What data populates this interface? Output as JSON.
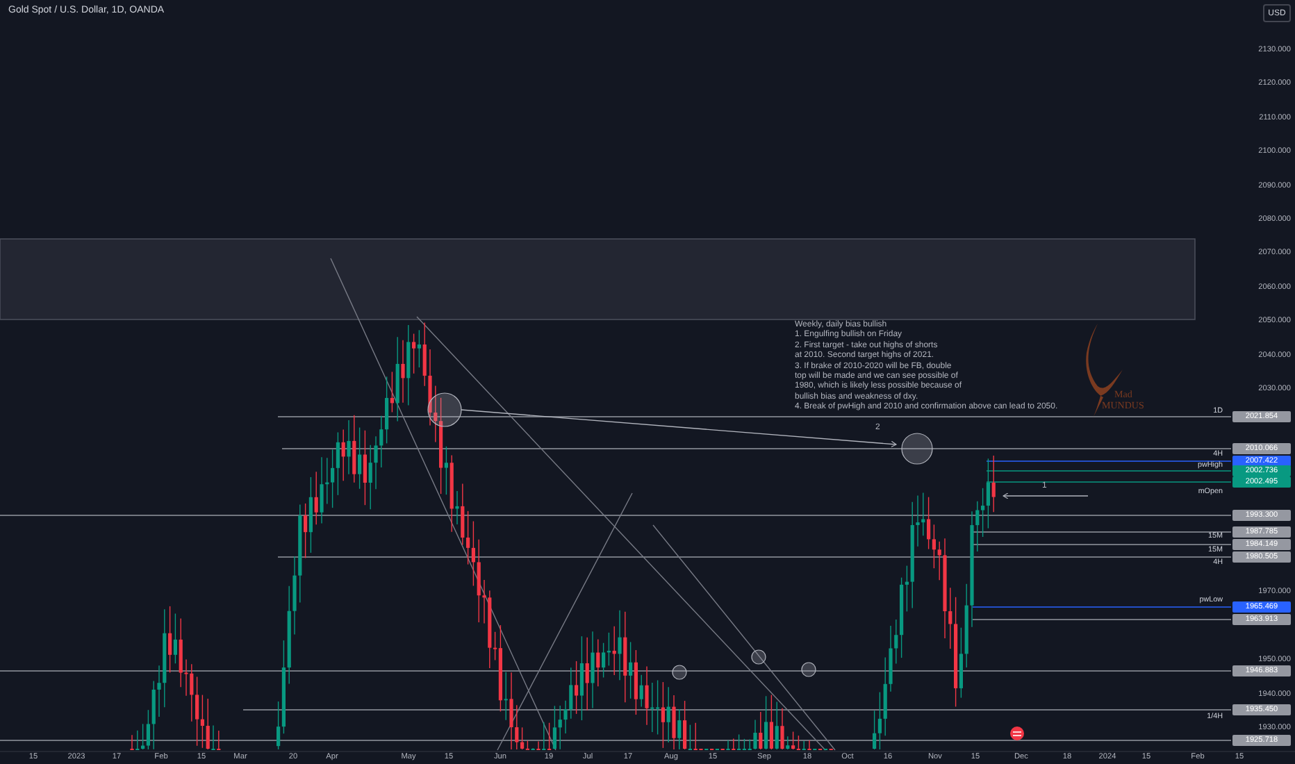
{
  "header": {
    "title": "Gold Spot / U.S. Dollar, 1D, OANDA",
    "currency": "USD"
  },
  "price_ticks": [
    "2130.000",
    "2120.000",
    "2110.000",
    "2100.000",
    "2090.000",
    "2080.000",
    "2070.000",
    "2060.000",
    "2050.000",
    "2040.000",
    "2030.000",
    "1970.000",
    "1950.000",
    "1940.000",
    "1930.000"
  ],
  "price_labels": [
    {
      "text": "2021.854",
      "color": "#9598a1"
    },
    {
      "text": "2010.066",
      "color": "#9598a1"
    },
    {
      "text": "2007.422",
      "color": "#2962ff"
    },
    {
      "text": "2002.736",
      "color": "#089981"
    },
    {
      "text": "2002.495",
      "color": "#089981"
    },
    {
      "text": "1993.300",
      "color": "#9598a1"
    },
    {
      "text": "1987.785",
      "color": "#9598a1"
    },
    {
      "text": "1984.149",
      "color": "#9598a1"
    },
    {
      "text": "1980.505",
      "color": "#9598a1"
    },
    {
      "text": "1965.469",
      "color": "#2962ff"
    },
    {
      "text": "1963.913",
      "color": "#9598a1"
    },
    {
      "text": "1946.883",
      "color": "#9598a1"
    },
    {
      "text": "1935.450",
      "color": "#9598a1"
    },
    {
      "text": "1925.718",
      "color": "#9598a1"
    }
  ],
  "line_tags": [
    "1D",
    "4H",
    "pwHigh",
    "mOpen",
    "15M",
    "15M",
    "4H",
    "pwLow",
    "1/4H"
  ],
  "time_axis": [
    "15",
    "2023",
    "17",
    "Feb",
    "15",
    "Mar",
    "20",
    "Apr",
    "May",
    "15",
    "Jun",
    "19",
    "Jul",
    "17",
    "Aug",
    "15",
    "Sep",
    "18",
    "Oct",
    "16",
    "Nov",
    "15",
    "Dec",
    "18",
    "2024",
    "15",
    "Feb",
    "15"
  ],
  "note": [
    "Weekly, daily bias bullish",
    "1. Engulfing bullish on Friday",
    "2. First target - take out highs of shorts",
    "at 2010. Second target highs of 2021.",
    "3. If brake of 2010-2020 will be FB, double",
    "top will be made and we can see possible of",
    "1980, which is likely less possible because of",
    "bullish bias and weakness of dxy.",
    "4. Break of pwHigh and 2010 and confirmation above can lead to 2050."
  ],
  "markers": [
    "2",
    "1"
  ],
  "logo": {
    "line1": "Mad",
    "line2": "MUNDUS"
  }
}
